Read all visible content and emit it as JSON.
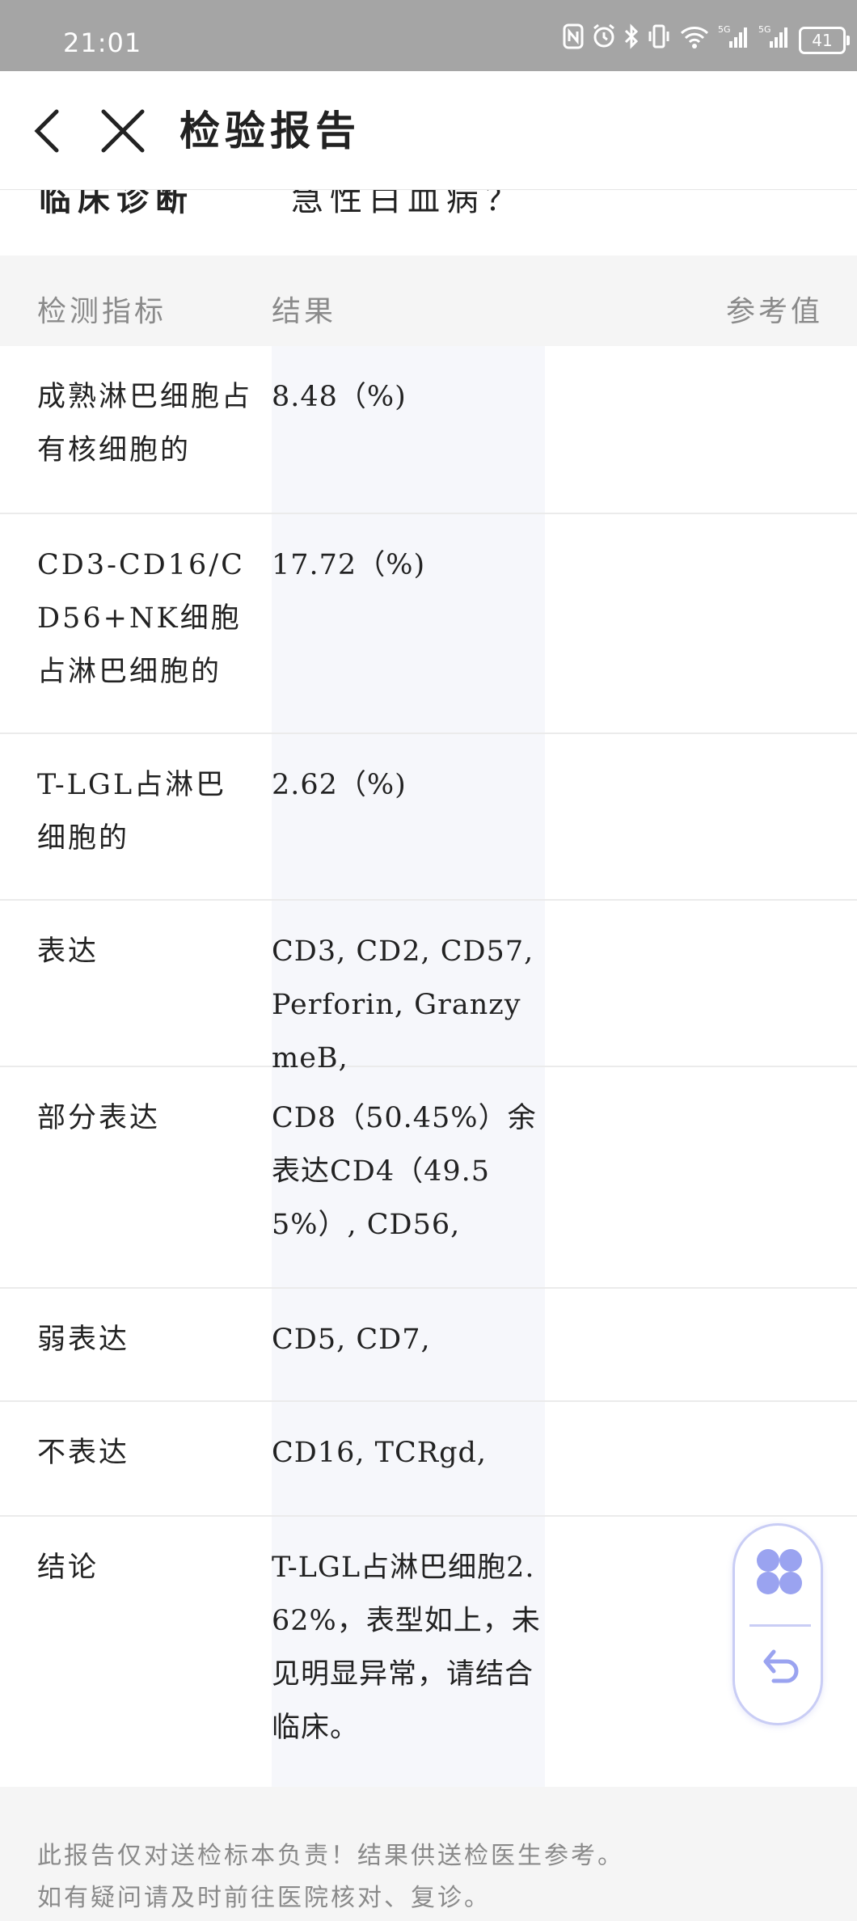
{
  "status_bar": {
    "time": "21:01",
    "icons": [
      "nfc-icon",
      "alarm-icon",
      "bluetooth-icon",
      "vibrate-icon",
      "wifi-icon",
      "signal-5g-icon",
      "signal-5g-icon"
    ],
    "battery": "41"
  },
  "header": {
    "title": "检验报告"
  },
  "diagnosis": {
    "label": "临床诊断",
    "value": "急性白血病？"
  },
  "table": {
    "columns": [
      "检测指标",
      "结果",
      "参考值"
    ],
    "rows": [
      {
        "name": "成熟淋巴细胞占有核细胞的",
        "value": "8.48（%)",
        "ref": ""
      },
      {
        "name": "CD3-CD16/CD56+NK细胞占淋巴细胞的",
        "value": "17.72（%)",
        "ref": ""
      },
      {
        "name": "T-LGL占淋巴细胞的",
        "value": "2.62（%)",
        "ref": ""
      },
      {
        "name": "表达",
        "value": "CD3, CD2, CD57, Perforin, GranzymeB,",
        "ref": ""
      },
      {
        "name": "部分表达",
        "value": "CD8（50.45%）余表达CD4（49.55%）, CD56,",
        "ref": ""
      },
      {
        "name": "弱表达",
        "value": "CD5, CD7,",
        "ref": ""
      },
      {
        "name": "不表达",
        "value": "CD16, TCRgd,",
        "ref": ""
      },
      {
        "name": "结论",
        "value": "T-LGL占淋巴细胞2.62%，表型如上，未见明显异常，请结合临床。",
        "ref": ""
      }
    ]
  },
  "footer": {
    "line1": "此报告仅对送检标本负责！结果供送检医生参考。",
    "line2": "如有疑问请及时前往医院核对、复诊。"
  },
  "colors": {
    "status_bar": "#a5a5a5",
    "header_bg": "#f5f5f5",
    "result_col_bg": "#f6f7fb",
    "accent_floater": "#9aa3f0"
  }
}
